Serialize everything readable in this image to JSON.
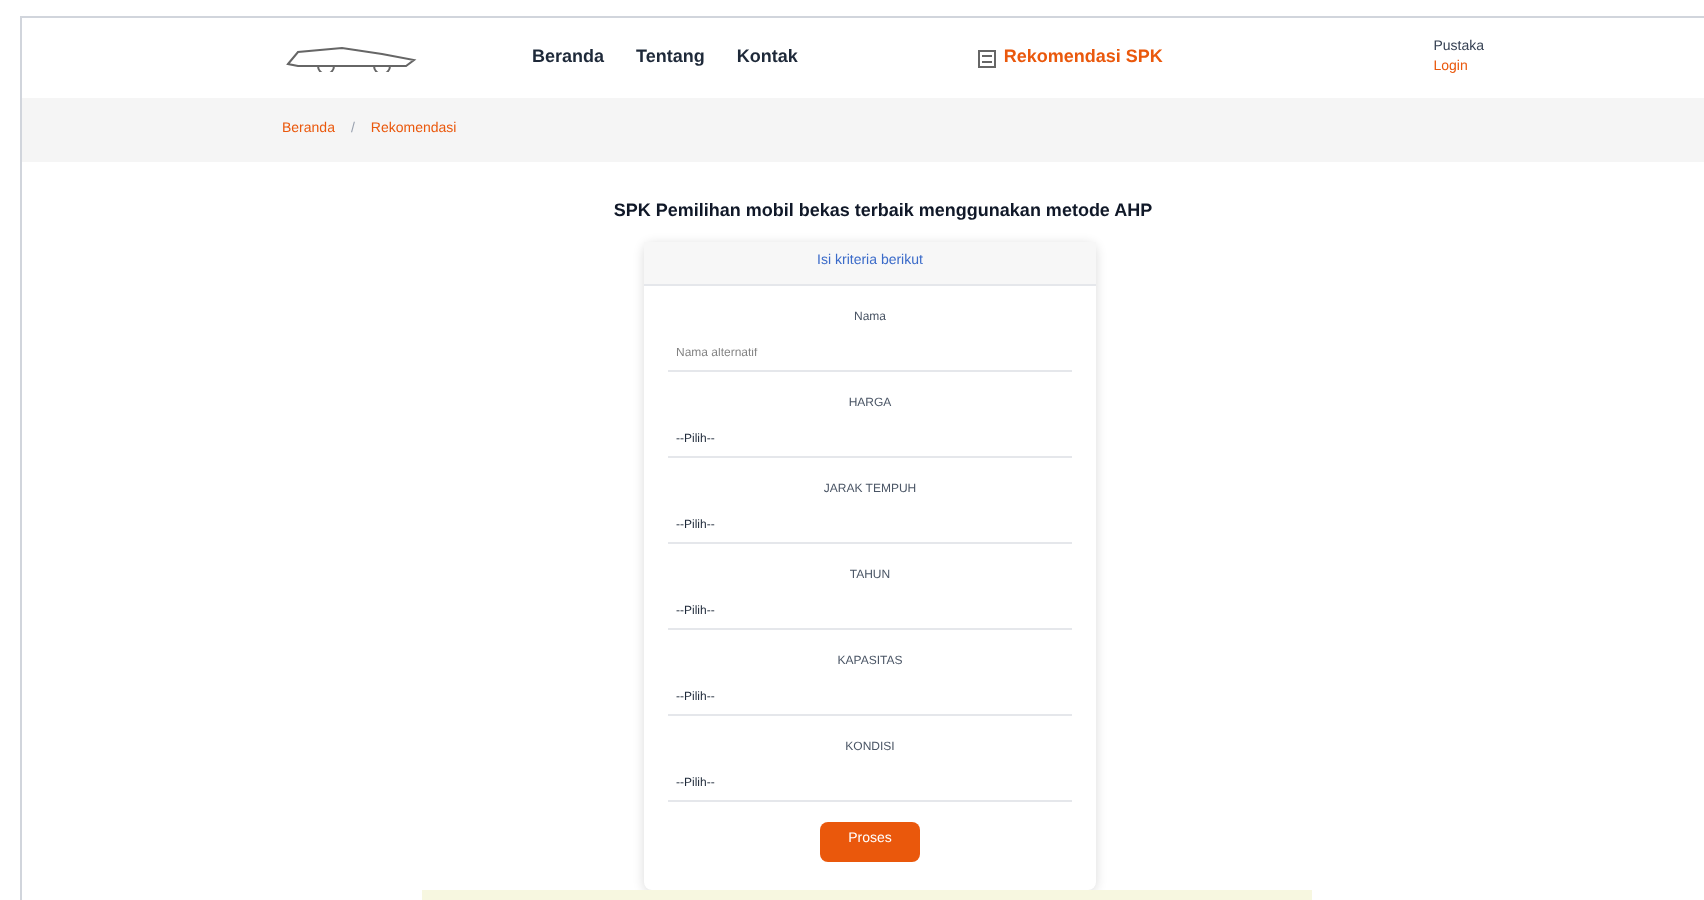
{
  "nav": {
    "links": [
      {
        "label": "Beranda"
      },
      {
        "label": "Tentang"
      },
      {
        "label": "Kontak"
      }
    ],
    "highlight": "Rekomendasi SPK",
    "user": [
      "Pustaka",
      "Login"
    ]
  },
  "breadcrumb": {
    "items": [
      "Beranda",
      "Rekomendasi"
    ],
    "separator": "/"
  },
  "title": "SPK Pemilihan mobil bekas terbaik menggunakan metode AHP",
  "form": {
    "header": "Isi kriteria berikut",
    "fields": [
      {
        "label": "Nama",
        "kind": "text",
        "placeholder": "Nama alternatif"
      },
      {
        "label": "HARGA",
        "kind": "select",
        "value": "--Pilih--"
      },
      {
        "label": "JARAK TEMPUH",
        "kind": "select",
        "value": "--Pilih--"
      },
      {
        "label": "TAHUN",
        "kind": "select",
        "value": "--Pilih--"
      },
      {
        "label": "KAPASITAS",
        "kind": "select",
        "value": "--Pilih--"
      },
      {
        "label": "KONDISI",
        "kind": "select",
        "value": "--Pilih--"
      }
    ],
    "button": "Proses"
  }
}
